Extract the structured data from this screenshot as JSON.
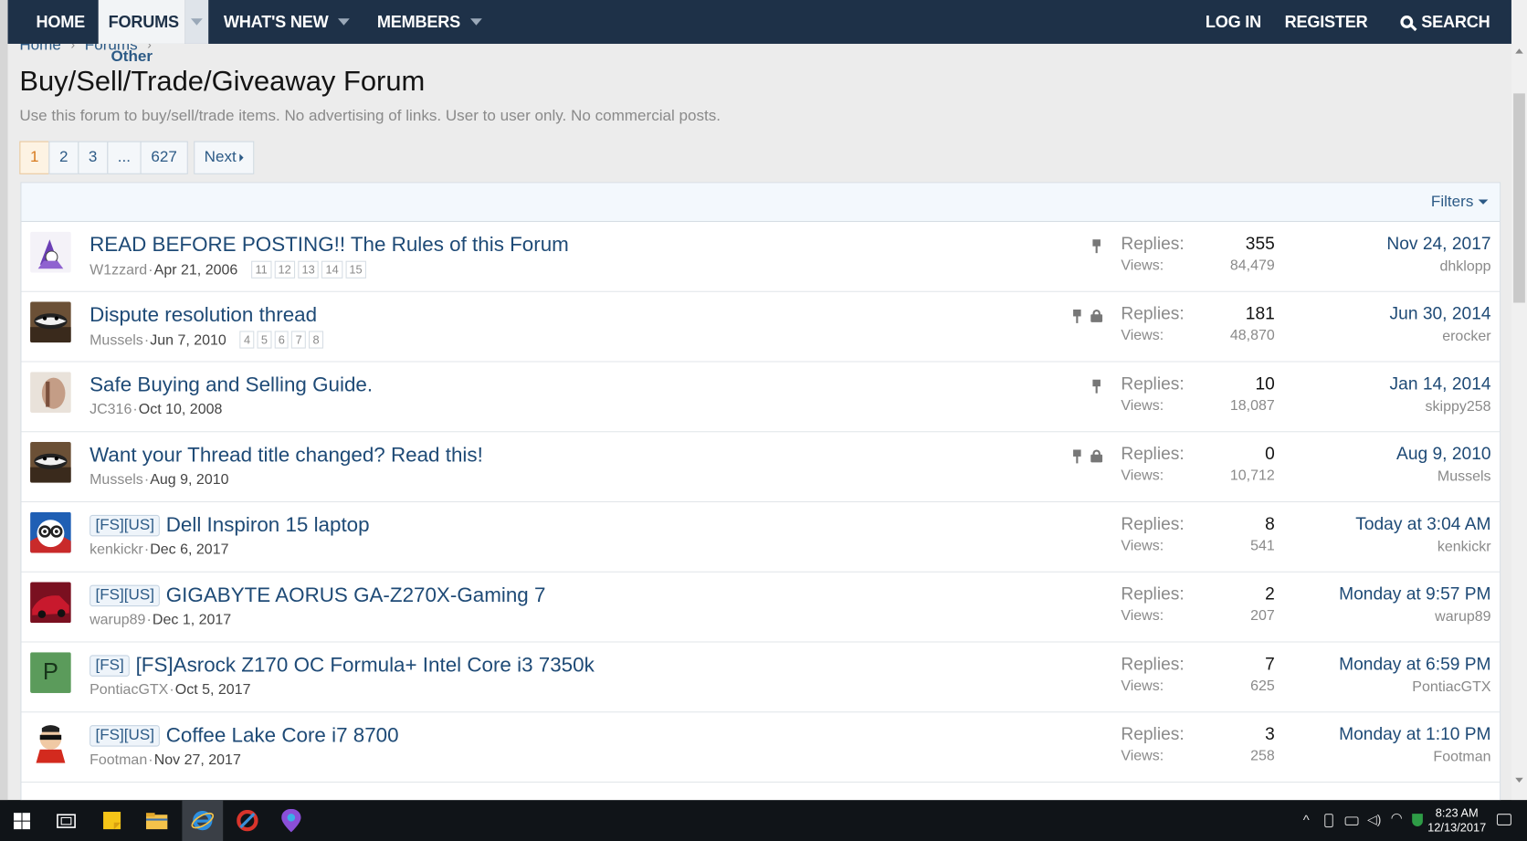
{
  "nav": {
    "home": "HOME",
    "forums": "FORUMS",
    "whats_new": "WHAT'S NEW",
    "members": "MEMBERS",
    "login": "LOG IN",
    "register": "REGISTER",
    "search": "SEARCH"
  },
  "breadcrumb": [
    "Home",
    "Forums",
    "Other"
  ],
  "page": {
    "title": "Buy/Sell/Trade/Giveaway Forum",
    "description": "Use this forum to buy/sell/trade items. No advertising of links. User to user only. No commercial posts."
  },
  "pagination": {
    "pages": [
      "1",
      "2",
      "3",
      "...",
      "627"
    ],
    "current": "1",
    "next": "Next"
  },
  "filters_label": "Filters",
  "labels": {
    "replies": "Replies:",
    "views": "Views:"
  },
  "threads": [
    {
      "prefix": "",
      "title": "READ BEFORE POSTING!! The Rules of this Forum",
      "author": "W1zzard",
      "date": "Apr 21, 2006",
      "pages": [
        "11",
        "12",
        "13",
        "14",
        "15"
      ],
      "pinned": true,
      "locked": false,
      "replies": "355",
      "views": "84,479",
      "last_date": "Nov 24, 2017",
      "last_user": "dhklopp",
      "avatar": "wizard"
    },
    {
      "prefix": "",
      "title": "Dispute resolution thread",
      "author": "Mussels",
      "date": "Jun 7, 2010",
      "pages": [
        "4",
        "5",
        "6",
        "7",
        "8"
      ],
      "pinned": true,
      "locked": true,
      "replies": "181",
      "views": "48,870",
      "last_date": "Jun 30, 2014",
      "last_user": "erocker",
      "avatar": "mussels"
    },
    {
      "prefix": "",
      "title": "Safe Buying and Selling Guide.",
      "author": "JC316",
      "date": "Oct 10, 2008",
      "pages": [],
      "pinned": true,
      "locked": false,
      "replies": "10",
      "views": "18,087",
      "last_date": "Jan 14, 2014",
      "last_user": "skippy258",
      "avatar": "photo"
    },
    {
      "prefix": "",
      "title": "Want your Thread title changed? Read this!",
      "author": "Mussels",
      "date": "Aug 9, 2010",
      "pages": [],
      "pinned": true,
      "locked": true,
      "replies": "0",
      "views": "10,712",
      "last_date": "Aug 9, 2010",
      "last_user": "Mussels",
      "avatar": "mussels"
    },
    {
      "prefix": "[FS][US]",
      "title": "Dell Inspiron 15 laptop",
      "author": "kenkickr",
      "date": "Dec 6, 2017",
      "pages": [],
      "pinned": false,
      "locked": false,
      "replies": "8",
      "views": "541",
      "last_date": "Today at 3:04 AM",
      "last_user": "kenkickr",
      "avatar": "glasses"
    },
    {
      "prefix": "[FS][US]",
      "title": "GIGABYTE AORUS GA-Z270X-Gaming 7",
      "author": "warup89",
      "date": "Dec 1, 2017",
      "pages": [],
      "pinned": false,
      "locked": false,
      "replies": "2",
      "views": "207",
      "last_date": "Monday at 9:57 PM",
      "last_user": "warup89",
      "avatar": "car"
    },
    {
      "prefix": "[FS]",
      "title": "[FS]Asrock Z170 OC Formula+ Intel Core i3 7350k",
      "author": "PontiacGTX",
      "date": "Oct 5, 2017",
      "pages": [],
      "pinned": false,
      "locked": false,
      "replies": "7",
      "views": "625",
      "last_date": "Monday at 6:59 PM",
      "last_user": "PontiacGTX",
      "avatar": "letter",
      "avatar_letter": "P"
    },
    {
      "prefix": "[FS][US]",
      "title": "Coffee Lake Core i7 8700",
      "author": "Footman",
      "date": "Nov 27, 2017",
      "pages": [],
      "pinned": false,
      "locked": false,
      "replies": "3",
      "views": "258",
      "last_date": "Monday at 1:10 PM",
      "last_user": "Footman",
      "avatar": "incredible"
    }
  ],
  "taskbar": {
    "time": "8:23 AM",
    "date": "12/13/2017"
  },
  "colors": {
    "nav_bg": "#1e3148",
    "link": "#1e4a76",
    "current_page": "#d77a1e"
  }
}
